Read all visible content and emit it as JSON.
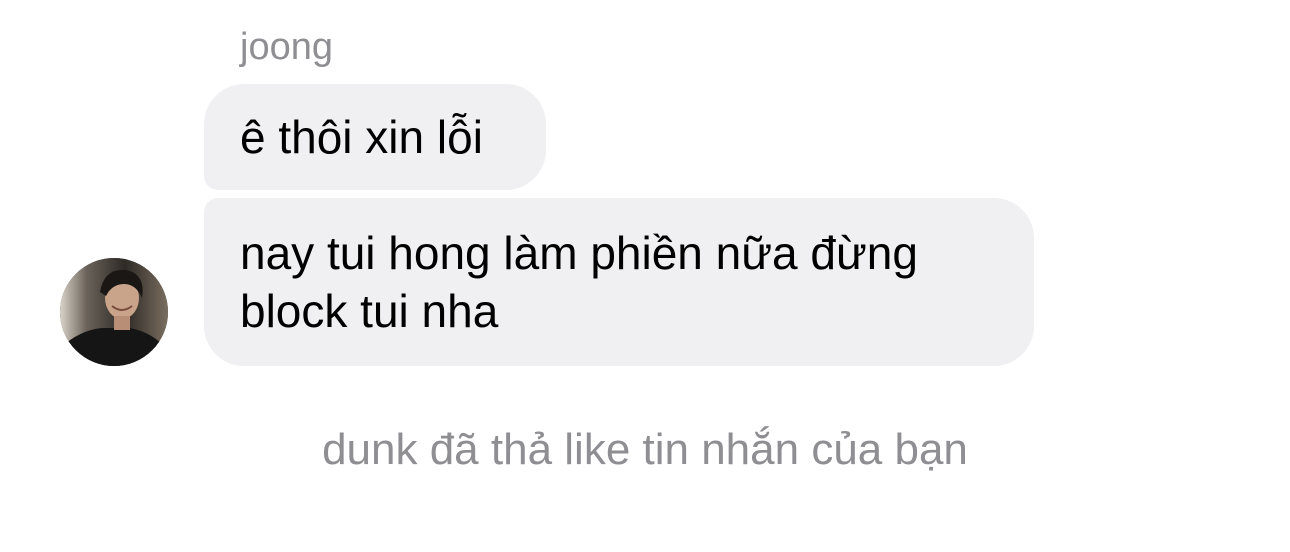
{
  "thread": {
    "sender_name": "joong",
    "messages": [
      {
        "lines": [
          "ê thôi xin lỗi"
        ]
      },
      {
        "lines": [
          "nay tui hong làm phiền nữa đừng",
          "block tui nha"
        ]
      }
    ],
    "avatar": {
      "icon": "profile-photo-icon"
    },
    "reaction_notice": "dunk đã thả like tin nhắn của bạn"
  },
  "colors": {
    "bubble_background": "#f0f0f2",
    "secondary_text": "#8e8e93",
    "primary_text": "#000000"
  }
}
